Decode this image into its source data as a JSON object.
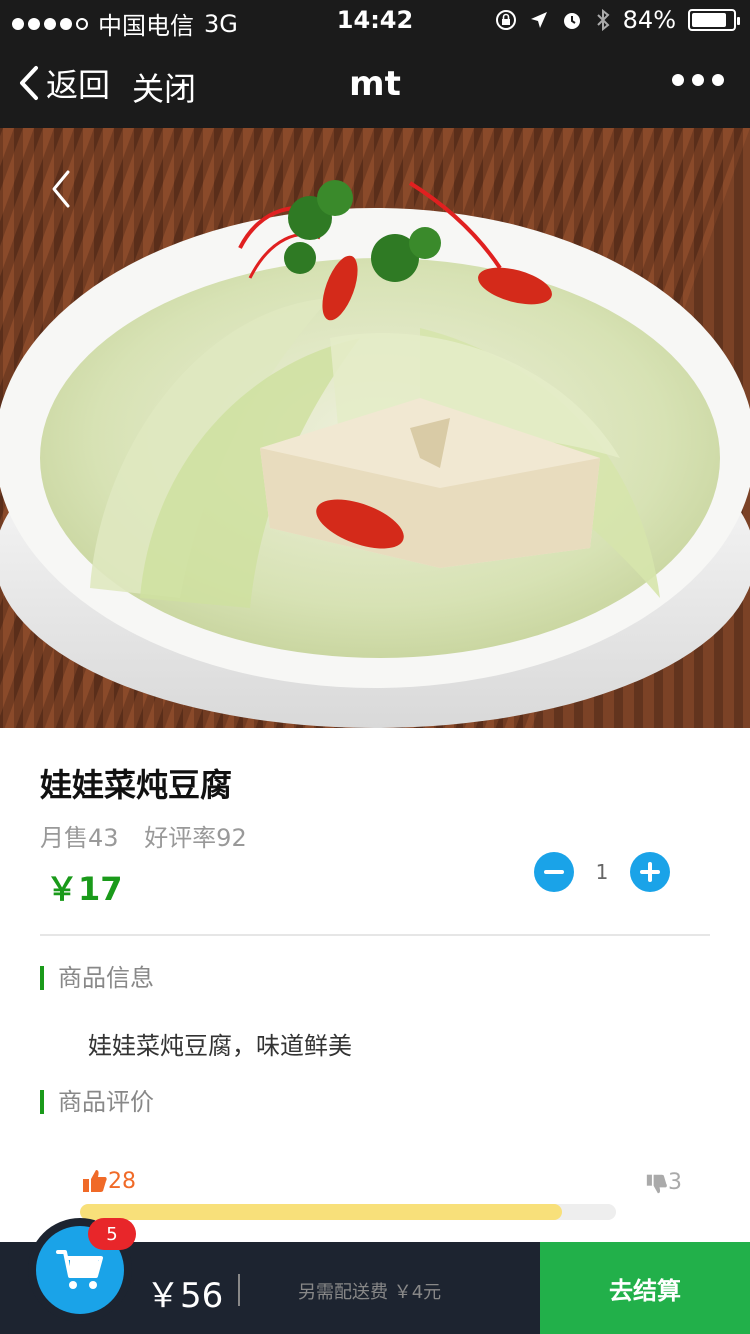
{
  "status_bar": {
    "carrier": "中国电信",
    "network": "3G",
    "time": "14:42",
    "battery_percent": "84%",
    "battery_level": 0.84
  },
  "nav": {
    "back_label": "返回",
    "close_label": "关闭",
    "title": "mt"
  },
  "product": {
    "name": "娃娃菜炖豆腐",
    "monthly_sales": "月售43",
    "good_rate": "好评率92",
    "price": "￥17",
    "quantity": "1"
  },
  "sections": {
    "info_title": "商品信息",
    "description": "娃娃菜炖豆腐，味道鲜美",
    "review_title": "商品评价"
  },
  "reviews": {
    "thumbs_up": "28",
    "thumbs_down": "3",
    "positive_fraction": 0.9
  },
  "cart": {
    "badge": "5",
    "total": "￥56",
    "delivery_note": "另需配送费 ￥4元",
    "checkout_label": "去结算"
  },
  "colors": {
    "accent_green": "#1a9a1a",
    "stepper_blue": "#1aa3e8",
    "checkout_green": "#22b04a",
    "badge_red": "#e8262a"
  }
}
